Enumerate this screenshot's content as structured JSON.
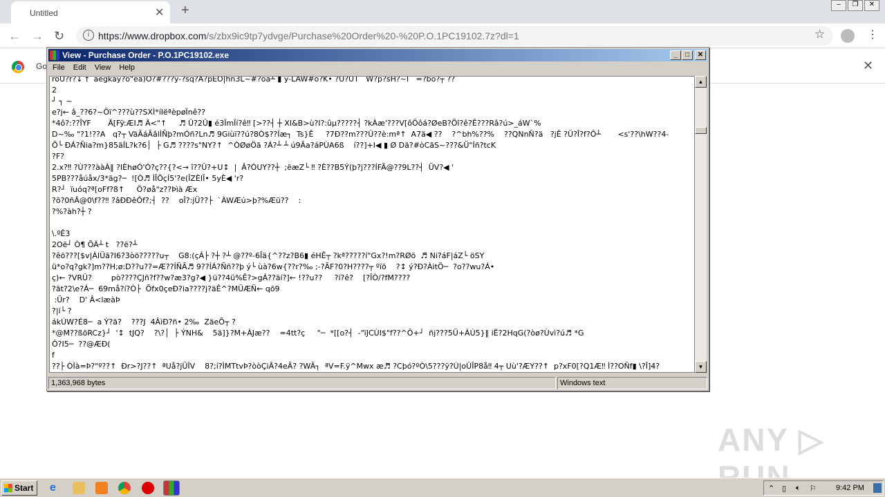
{
  "browser": {
    "tab_title": "Untitled",
    "url_host": "https://www.dropbox.com",
    "url_path": "/s/zbx9ic9tp7ydvge/Purchase%20Order%20-%20P.O.1PC19102.7z?dl=1",
    "infobar_text": "Go"
  },
  "window": {
    "title": "View - Purchase Order - P.O.1PC19102.exe",
    "menu": [
      "File",
      "Edit",
      "View",
      "Help"
    ],
    "content_lines": [
      "roU?r?↓ †  aegkay?o\"ea)O?#???y-?sq?A?pEO|hn3L~#?oa┴ ▮ y-LAW#o?K• ?U?UT   W?p?sH?~I   =?bo?┬ ??",
      "2",
      "┘ ┐ ~",
      "e?j← â_??6?~Öï^???ù??SXÌ*íIëªèpøÏnê??",
      "*4ô?:??ÎYF       Ä[Fÿ:ÆI♬ Ä<\"↑     ♬ Û?2Û▮ é3ÏmÏí?ê‼ [>??┤ ┼ XI&B>ù?I?:ûµ?????┤ ?kÀæ'???V[ôÖôá?ØeB?Õî?ê?Ê???Râ?ú>_áW`%",
      "D~‰ \"?1!??A   q?┬ VäÃáÃâlÌÑþ?mÓñ?Ln♬ 9Giùï??ú?8Ò$??Íæ┐  Ts}Ê     ?7Ð??m???Û??è:mª↑  A7ä◀ ??    ?^bh%??%    ??QNnÑ?ä   ?jÊ ?Ü?Î?f?Ô┴       <s'??\\hW??4-",
      "Õ└ ÐÁ?Ñia?m}85äÍL?k?6│  ├ G♬ ????s\"NY?↑  ^ÒØøÖã ?Á?┴ ┴ ú9Ãa?áPÙA6ß    í??]+I◀ ▮ Ø Dä?#òCãS~???&Ü\"Íñ?tcK",
      "?F?",
      "2.x?‼ ?Ù???ààÀ‖ ?IÈhøÓ'Ó?ç??{?<→ î??Û?+U↕  |  Â?ÓUY??┼  ;ëæZ└ ‼ ?È??B5Ý(þ?j???ÍFÃ@??9L??┤  ÜV?◀ '",
      "5PB???åúåx/3*äg?─  ![Ò♬ ÌÎÔçÍ5'?e(ÎZÈIÎ• 5yÈ◀ 'r?",
      "R?┘  ïuóq?ª[oFf?8↑     Ö?øå\"z??Þìà Æx",
      "?õ?0ñÂ@0\\f??‼ ?âÐÐêÔf?;┤  ??    oÎ?:jÜ??├  `ÀWÆú>þ?%Æü??    :",
      "?%?àh?┼ ?",
      "",
      "\\.ºÊ3",
      "2Oë┘ Ò¶ ÕÄ┴ t   ??ë?┴",
      "?êö???[$v|ÀIÜã?I6?3òö?????u┬    G8:(çÁ├ ?┼ ?┴ @??º-6Îä{^??z?B6▮ éHÊ┬ ?kª?????í\"Gx?!m?RØö  ♬ Ni?áF|áZ└ öSY",
      "ü*o?q?gk?]m??H;ø:D??u??=Æ??ÍÑÃ♬ 9??ÍÁ?Ññ??þ ý└ ùà?6w{??r?‰ ;-?ÃF?0?H????┬ ºïõ    ?↕ ý?Ð?ÀitÖ─  ?o??wu?Á•",
      "ç)← ?VRÛ?        pò????ÇJñ?f??w?æ3?g?◀ }ü??4ü%Ê?>gÁ??äí?]← !??u??     ?í?ê?    [?ÎÒ/?fM????",
      "?ãt?2\\e?Á─  69må?í?Ò├  Õfx0çeÐ?ia????j?äÊ^?MÜÆÑ← qõ9",
      " :Ür?    D' Â<læàÞ",
      "?|í└ ?",
      "ákÚW?É8─  a Ý?ã?    ???J  4ÂìÐ?ñ• 2‰  ZäeÕ┬ ?",
      "*@M??ßõRCz}┘  '↕  tJQ?    ?\\?│  ├ ÝNH&    5ä]}?M+ÀJæ??    =4tt?ç     \"─  *[[o?┤  -\"ïJCÙI$\"f??^Ô+┘  ñj???5Ü+ÀÚ5}‖ iË?2HqG(?òø?Ùvì?ú♬ *G",
      "Ô?I5─  ??@ÆÐ(",
      "f",
      "??├ ÒÌà=Þ?\"º??↑  Ðr>?J??↑  ªUå?jÜÎV    8?;í?ÌMTtvÞ?òòÇiÂ?4eÃ? ?WÃ┐  ªV=F.ÿ^Mwx æ♬ ?Cþó?ºÒ\\5???ÿ?Ú|oÛÎP8å‼ 4┬ Uù'?ÆY??↑  p?xF0[?Q1Æ‼ Ì??OÑf▮ \\?Î]4?"
    ],
    "status_size": "1,363,968 bytes",
    "status_encoding": "Windows text"
  },
  "taskbar": {
    "start_label": "Start",
    "clock": "9:42 PM"
  },
  "watermark": "ANY RUN"
}
